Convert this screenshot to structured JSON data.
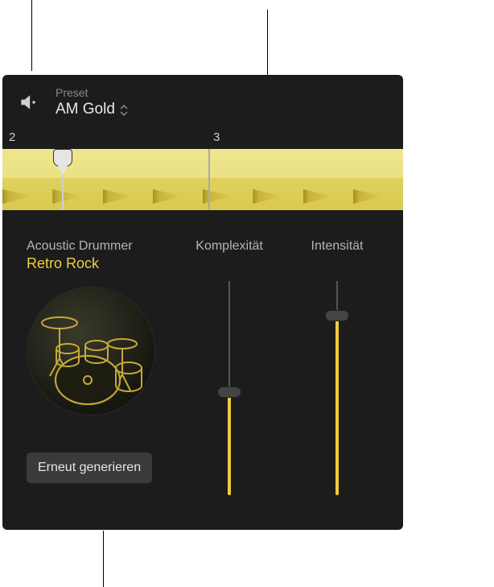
{
  "header": {
    "preset_label": "Preset",
    "preset_name": "AM Gold"
  },
  "timeline": {
    "markers": [
      "2",
      "3"
    ]
  },
  "drummer": {
    "type": "Acoustic Drummer",
    "style": "Retro Rock",
    "regenerate_label": "Erneut generieren"
  },
  "sliders": {
    "complexity": {
      "label": "Komplexität",
      "value": 48
    },
    "intensity": {
      "label": "Intensität",
      "value": 84
    }
  }
}
